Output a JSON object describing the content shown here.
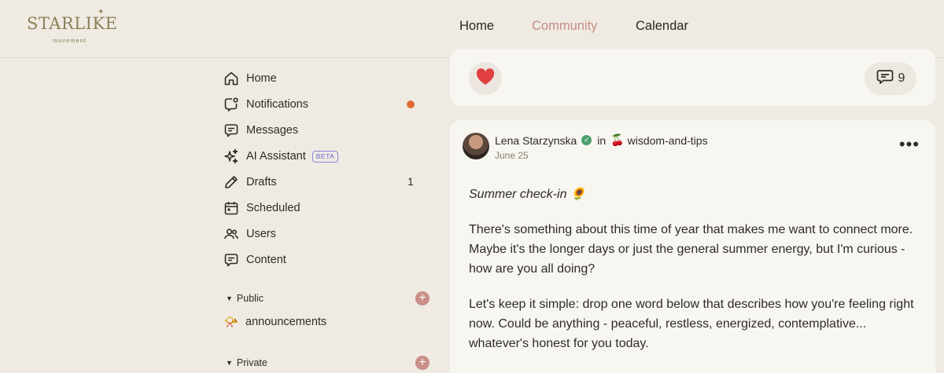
{
  "brand": {
    "name": "STARLIKE",
    "tagline": "movement"
  },
  "nav": [
    {
      "label": "Home",
      "active": false
    },
    {
      "label": "Community",
      "active": true
    },
    {
      "label": "Calendar",
      "active": false
    }
  ],
  "sidebar": {
    "items": [
      {
        "label": "Home",
        "icon": "home-icon"
      },
      {
        "label": "Notifications",
        "icon": "bell-icon",
        "unread": true
      },
      {
        "label": "Messages",
        "icon": "message-icon"
      },
      {
        "label": "AI Assistant",
        "icon": "sparkles-icon",
        "badge": "BETA"
      },
      {
        "label": "Drafts",
        "icon": "pencil-icon",
        "count": "1"
      },
      {
        "label": "Scheduled",
        "icon": "calendar-icon"
      },
      {
        "label": "Users",
        "icon": "users-icon"
      },
      {
        "label": "Content",
        "icon": "content-icon"
      }
    ],
    "sections": [
      {
        "label": "Public",
        "channels": [
          {
            "label": "announcements",
            "emoji": "📯"
          }
        ]
      },
      {
        "label": "Private",
        "channels": []
      }
    ]
  },
  "previous_post": {
    "comment_count": "9"
  },
  "post": {
    "author": "Lena Starzynska",
    "in_word": "in",
    "category_emoji": "🍒",
    "category": "wisdom-and-tips",
    "date": "June 25",
    "title": "Summer check-in 🌻",
    "paragraphs": [
      "There's something about this time of year that makes me want to connect more. Maybe it's the longer days or just the general summer energy, but I'm curious - how are you all doing?",
      "Let's keep it simple: drop one word below that describes how you're feeling right now. Could be anything - peaceful, restless, energized, contemplative... whatever's honest for you today."
    ]
  },
  "colors": {
    "background": "#efebe3",
    "card": "#f8f6f1",
    "accent": "#d39a93",
    "notification_dot": "#df6b33",
    "like": "#e0403f",
    "verified": "#4aa06a",
    "brand": "#8b7f57"
  }
}
